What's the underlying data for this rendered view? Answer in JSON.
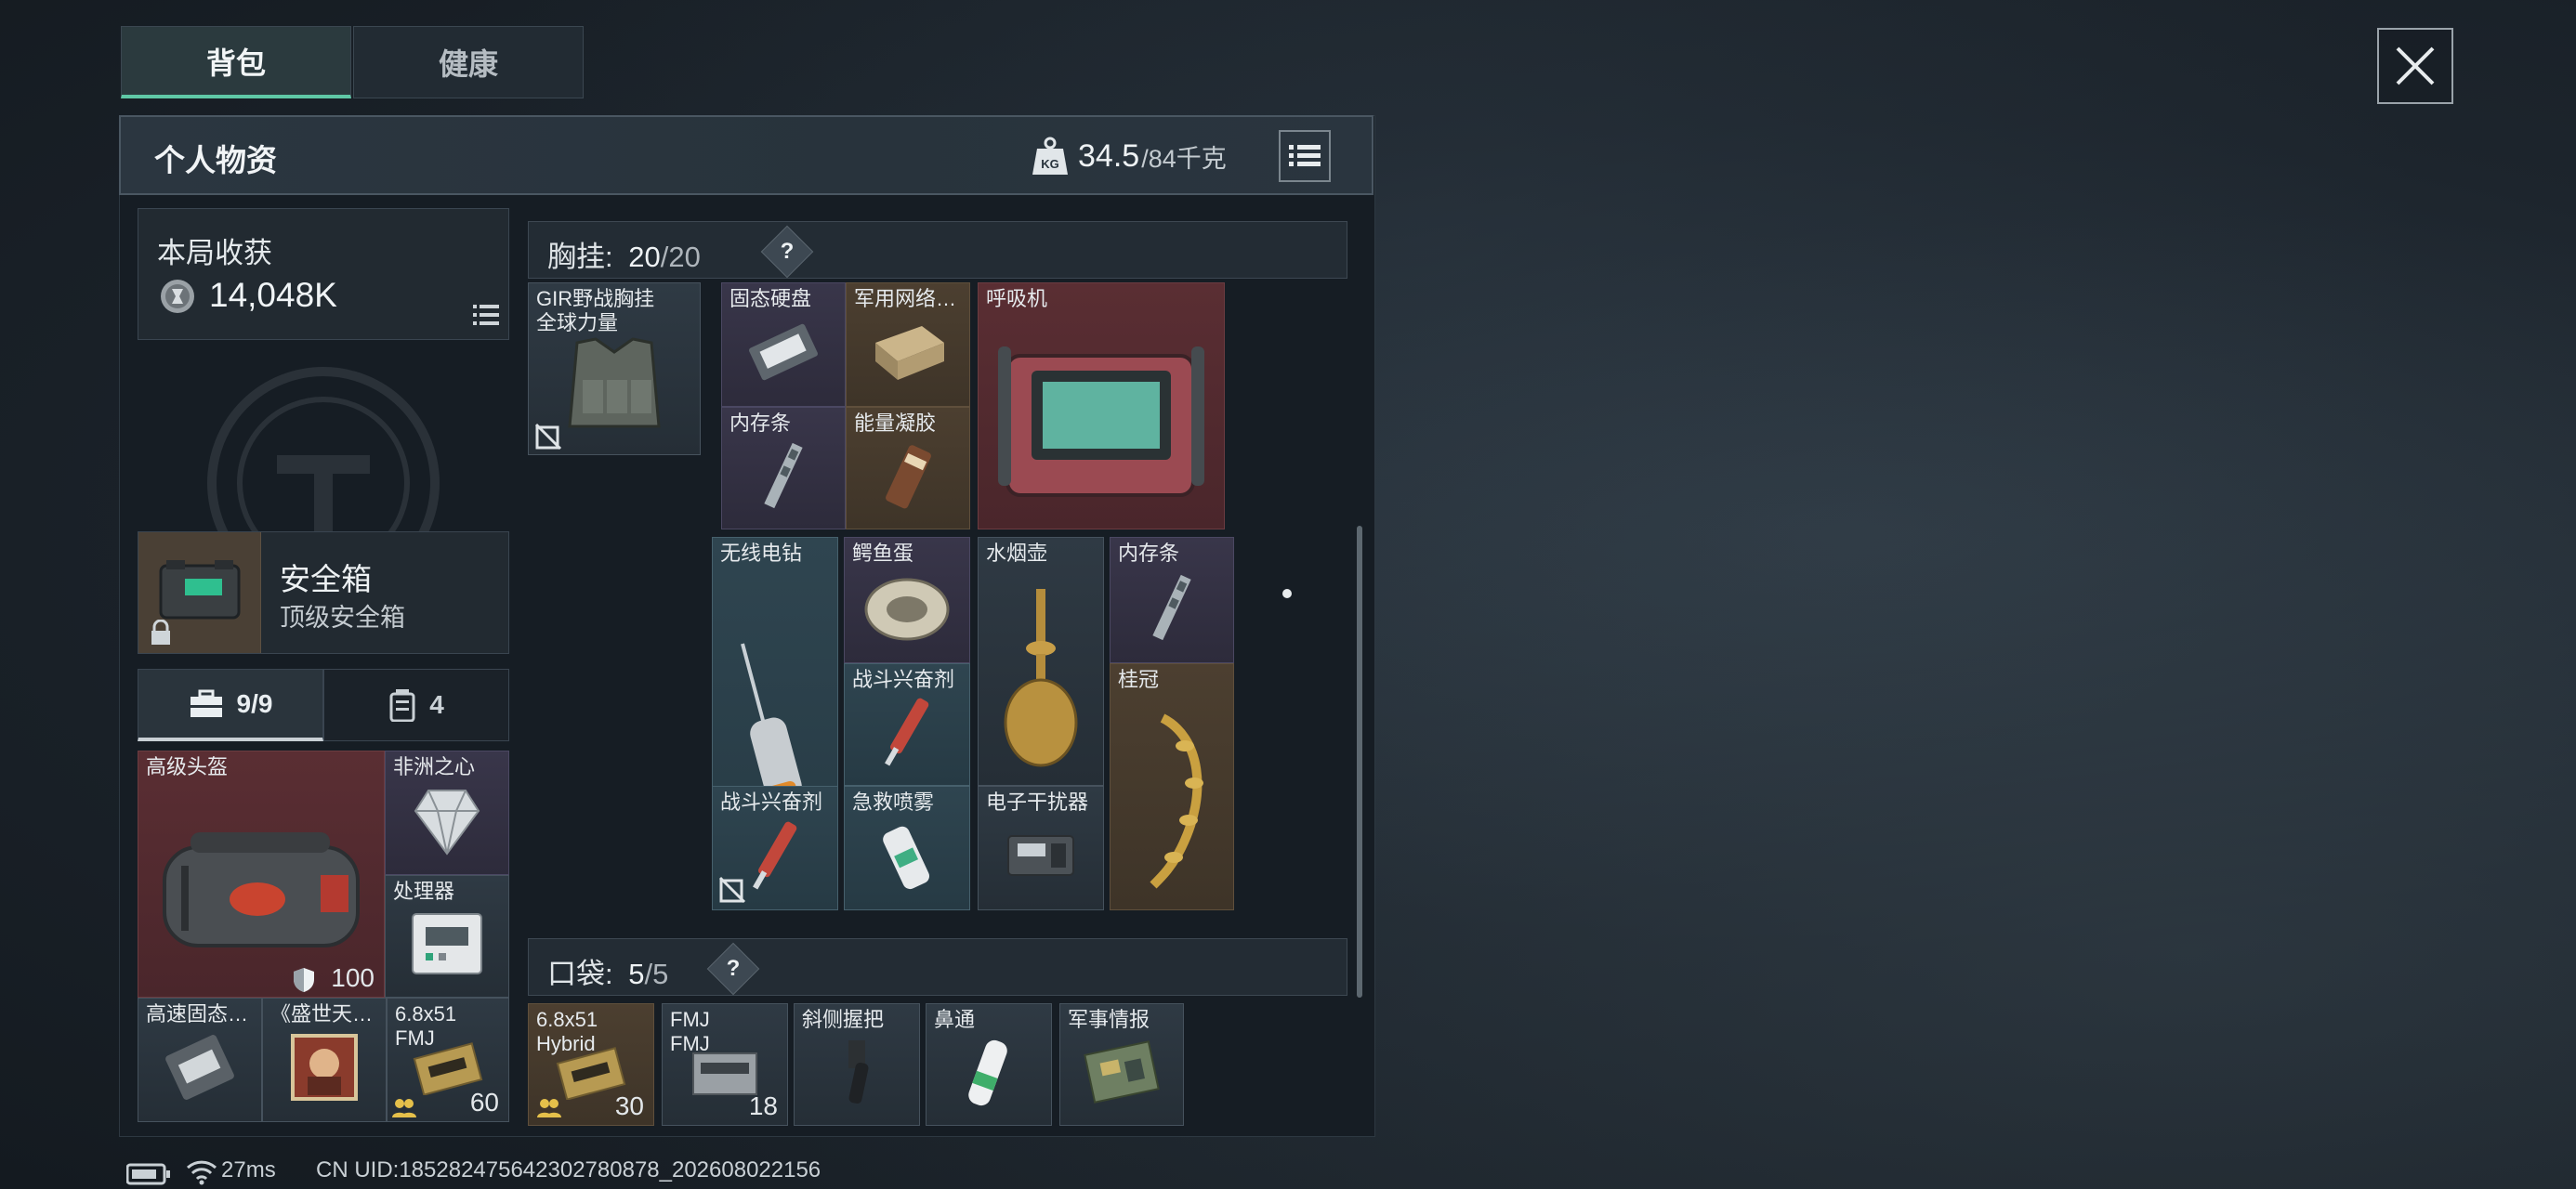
{
  "tabs": [
    {
      "label": "背包",
      "active": true
    },
    {
      "label": "健康",
      "active": false
    }
  ],
  "panel": {
    "title": "个人物资",
    "weight_value": "34.5",
    "weight_max": "/84千克",
    "weight_icon_text": "KG"
  },
  "earnings": {
    "label": "本局收获",
    "value": "14,048K"
  },
  "safebox": {
    "title": "安全箱",
    "subtitle": "顶级安全箱"
  },
  "slot_tabs": [
    {
      "label": "9/9",
      "active": true
    },
    {
      "label": "4",
      "active": false
    }
  ],
  "left_items": [
    {
      "name": "高级头盔",
      "count": "100"
    },
    {
      "name": "非洲之心"
    },
    {
      "name": "处理器"
    },
    {
      "name": "高速固态…"
    },
    {
      "name": "《盛世天…"
    },
    {
      "name": "6.8x51",
      "name2": "FMJ",
      "count": "60"
    }
  ],
  "chest": {
    "label": "胸挂:",
    "used": "20",
    "total": "/20",
    "help": "?",
    "rig_name": "GIR野战胸挂",
    "rig_name2": "全球力量",
    "items": [
      {
        "name": "固态硬盘"
      },
      {
        "name": "军用网络…"
      },
      {
        "name": "呼吸机"
      },
      {
        "name": "内存条"
      },
      {
        "name": "能量凝胶"
      },
      {
        "name": "无线电钻"
      },
      {
        "name": "鳄鱼蛋"
      },
      {
        "name": "水烟壶"
      },
      {
        "name": "内存条"
      },
      {
        "name": "战斗兴奋剂"
      },
      {
        "name": "桂冠"
      },
      {
        "name": "战斗兴奋剂"
      },
      {
        "name": "急救喷雾"
      },
      {
        "name": "电子干扰器"
      }
    ]
  },
  "pocket": {
    "label": "口袋:",
    "used": "5",
    "total": "/5",
    "help": "?",
    "items": [
      {
        "name": "6.8x51",
        "name2": "Hybrid",
        "count": "30"
      },
      {
        "name": "FMJ",
        "name2": "FMJ",
        "count": "18"
      },
      {
        "name": "斜侧握把"
      },
      {
        "name": "鼻通"
      },
      {
        "name": "军事情报"
      }
    ]
  },
  "status": {
    "ping": "27ms",
    "uid": "CN UID:185282475642302780878_202608022156"
  },
  "colors": {
    "accent": "#5fc8a6",
    "red_item": "#5a2e33",
    "blue_item": "#2f4550",
    "brown_item": "#4c3f30"
  }
}
